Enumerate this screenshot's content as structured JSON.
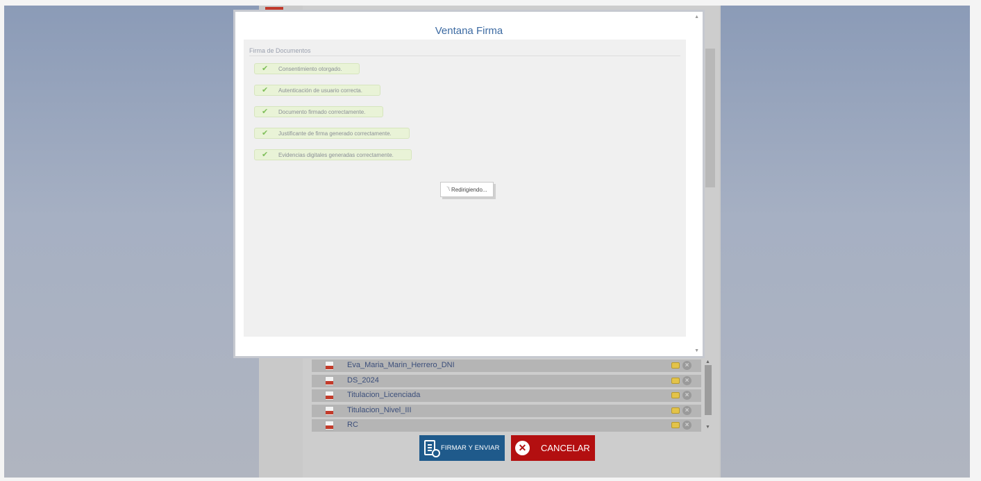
{
  "modal": {
    "title": "Ventana Firma",
    "section_title": "Firma de Documentos",
    "status_items": [
      "Consentimiento otorgado.",
      "Autenticación de usuario correcta.",
      "Documento firmado correctamente.",
      "Justificante de firma generado correctamente.",
      "Evidencias digitales generadas correctamente."
    ],
    "redirect_text": "Redirigiendo..."
  },
  "files": [
    "Eva_Maria_Marin_Herrero_DNI",
    "DS_2024",
    "Titulacion_Licenciada",
    "Titulacion_Nivel_III",
    "RC"
  ],
  "buttons": {
    "sign_label": "FIRMAR Y ENVIAR",
    "cancel_label": "CANCELAR"
  },
  "colors": {
    "sign_button": "#1f5a8b",
    "cancel_button": "#b30f10",
    "title": "#3c6aa2",
    "success_check": "#7fbf5a"
  }
}
